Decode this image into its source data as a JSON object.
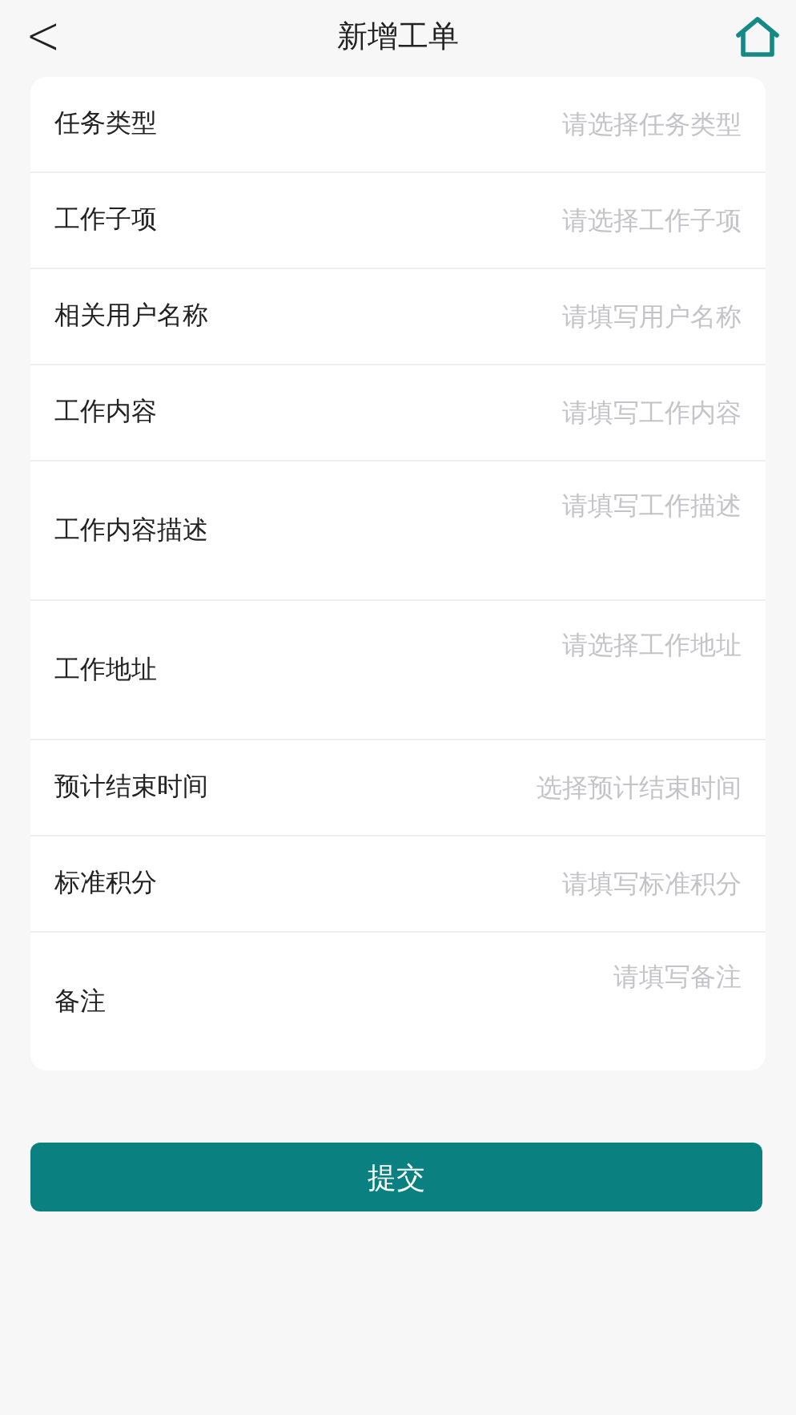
{
  "header": {
    "back": "<",
    "title": "新增工单"
  },
  "form": {
    "rows": [
      {
        "kind": "line",
        "label": "任务类型",
        "placeholder": "请选择任务类型"
      },
      {
        "kind": "line",
        "label": "工作子项",
        "placeholder": "请选择工作子项"
      },
      {
        "kind": "line",
        "label": "相关用户名称",
        "placeholder": "请填写用户名称"
      },
      {
        "kind": "line",
        "label": "工作内容",
        "placeholder": "请填写工作内容"
      },
      {
        "kind": "area",
        "label": "工作内容描述",
        "placeholder": "请填写工作描述"
      },
      {
        "kind": "area",
        "label": "工作地址",
        "placeholder": "请选择工作地址"
      },
      {
        "kind": "line",
        "label": "预计结束时间",
        "placeholder": "选择预计结束时间"
      },
      {
        "kind": "line",
        "label": "标准积分",
        "placeholder": "请填写标准积分"
      },
      {
        "kind": "area",
        "label": "备注",
        "placeholder": "请填写备注"
      }
    ]
  },
  "submit": "提交"
}
